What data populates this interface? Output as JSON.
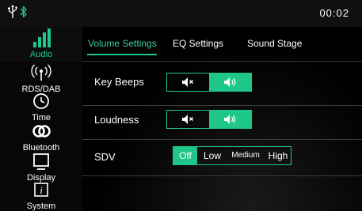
{
  "status": {
    "time": "00:02",
    "icons": [
      "usb-icon",
      "bluetooth-icon"
    ]
  },
  "colors": {
    "accent": "#1fc68a"
  },
  "sidebar": {
    "items": [
      {
        "label": "Audio",
        "icon": "equalizer-bars-icon",
        "active": true
      },
      {
        "label": "RDS/DAB",
        "icon": "radio-waves-icon"
      },
      {
        "label": "Time",
        "icon": "clock-icon"
      },
      {
        "label": "Bluetooth",
        "icon": "link-icon"
      },
      {
        "label": "Display",
        "icon": "monitor-icon"
      },
      {
        "label": "System",
        "icon": "info-icon"
      }
    ]
  },
  "tabs": [
    {
      "label": "Volume Settings",
      "active": true
    },
    {
      "label": "EQ Settings"
    },
    {
      "label": "Sound Stage"
    }
  ],
  "settings": {
    "key_beeps": {
      "label": "Key Beeps",
      "options": [
        "speaker-mute-icon",
        "speaker-on-icon"
      ],
      "selected": "speaker-on-icon"
    },
    "loudness": {
      "label": "Loudness",
      "options": [
        "speaker-mute-icon",
        "speaker-on-icon"
      ],
      "selected": "speaker-on-icon"
    },
    "sdv": {
      "label": "SDV",
      "options": [
        "Off",
        "Low",
        "Medium",
        "High"
      ],
      "selected": "Off"
    }
  }
}
